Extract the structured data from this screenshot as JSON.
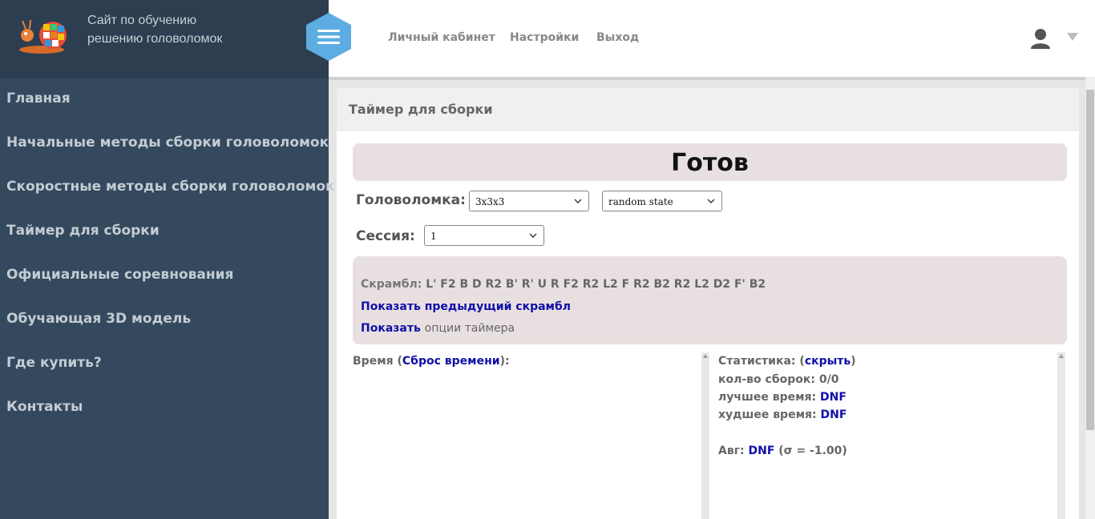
{
  "brand": {
    "site_title": "Сайт по обучению решению головоломок"
  },
  "sidebar": {
    "items": [
      {
        "label": "Главная"
      },
      {
        "label": "Начальные методы сборки головоломок"
      },
      {
        "label": "Скоростные методы сборки головоломок"
      },
      {
        "label": "Таймер для сборки"
      },
      {
        "label": "Официальные соревнования"
      },
      {
        "label": "Обучающая 3D модель"
      },
      {
        "label": "Где купить?"
      },
      {
        "label": "Контакты"
      }
    ]
  },
  "topbar": {
    "links": [
      {
        "label": "Личный кабинет"
      },
      {
        "label": "Настройки"
      },
      {
        "label": "Выход"
      }
    ],
    "icons": [
      "hamburger-menu-icon",
      "user-icon",
      "caret-down-icon"
    ]
  },
  "panel": {
    "title": "Таймер для сборки",
    "status": "Готов",
    "puzzle_label": "Головоломка:",
    "puzzle_select": "3x3x3",
    "scramble_type_select": "random state",
    "session_label": "Сессия:",
    "session_select": "1",
    "scramble_label": "Скрамбл:",
    "scramble": "L' F2 B D R2 B' R' U R F2 R2 L2 F R2 B2 R2 L2 D2 F' B2",
    "show_prev_scramble": "Показать предыдущий скрамбл",
    "show_link": "Показать",
    "timer_options": "опции таймера",
    "times_label_pre": "Время (",
    "reset_times": "Сброс времени",
    "times_label_post": "):",
    "stats": {
      "title_pre": "Статистика: (",
      "hide": "скрыть",
      "title_post": ")",
      "count_label": "кол-во сборок: 0/0",
      "best_label": "лучшее время:",
      "best_value": "DNF",
      "worst_label": "худшее время:",
      "worst_value": "DNF",
      "avg_label": "Авг:",
      "avg_value": "DNF",
      "avg_sigma": "(σ = -1.00)"
    }
  },
  "colors": {
    "sidebar": "#34495e",
    "brand": "#2c3e50",
    "accent": "#5dade2",
    "link": "#1010a8",
    "ready_bg": "#e8e0e0"
  }
}
